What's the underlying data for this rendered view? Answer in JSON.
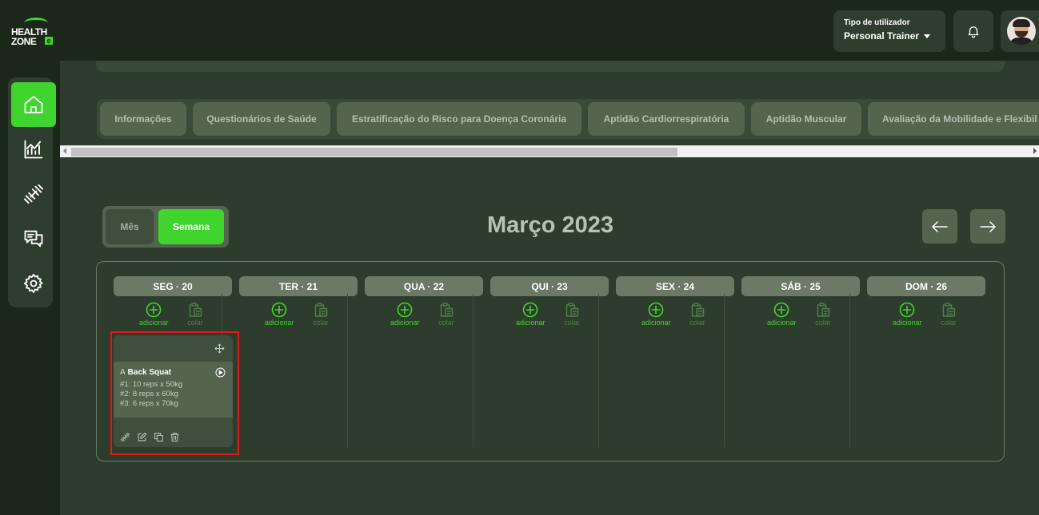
{
  "logo": {
    "line1": "HEALTH",
    "line2": "ZONE",
    "badge": "e"
  },
  "header": {
    "user_type_label": "Tipo de utilizador",
    "user_type_value": "Personal Trainer"
  },
  "nav": {
    "items": [
      {
        "name": "home",
        "icon": "home-icon",
        "active": true
      },
      {
        "name": "statistics",
        "icon": "chart-icon",
        "active": false
      },
      {
        "name": "workouts",
        "icon": "dumbbell-icon",
        "active": false
      },
      {
        "name": "messages",
        "icon": "chat-icon",
        "active": false
      },
      {
        "name": "settings",
        "icon": "gear-icon",
        "active": false
      }
    ]
  },
  "tabs": [
    {
      "label": "Informações"
    },
    {
      "label": "Questionários de Saúde"
    },
    {
      "label": "Estratificação do Risco para Doença Coronária"
    },
    {
      "label": "Aptidão Cardiorrespiratória"
    },
    {
      "label": "Aptidão Muscular"
    },
    {
      "label": "Avaliação da Mobilidade e Flexibil"
    }
  ],
  "view_toggle": {
    "month_label": "Mês",
    "week_label": "Semana",
    "selected": "week"
  },
  "calendar": {
    "month_title": "Março 2023",
    "add_label": "adicionar",
    "paste_label": "colar",
    "days": [
      {
        "label": "SEG · 20"
      },
      {
        "label": "TER · 21"
      },
      {
        "label": "QUA · 22"
      },
      {
        "label": "QUI · 23"
      },
      {
        "label": "SEX · 24"
      },
      {
        "label": "SÁB · 25"
      },
      {
        "label": "DOM · 26"
      }
    ]
  },
  "workout_card": {
    "letter": "A",
    "exercise": "Back Squat",
    "sets": [
      "#1: 10 reps x 50kg",
      "#2: 8 reps x 60kg",
      "#3: 6 reps x 70kg"
    ]
  },
  "colors": {
    "accent": "#3fd52e",
    "background": "#2e3c2d",
    "dark": "#1b2819",
    "highlight": "#e0191b"
  }
}
